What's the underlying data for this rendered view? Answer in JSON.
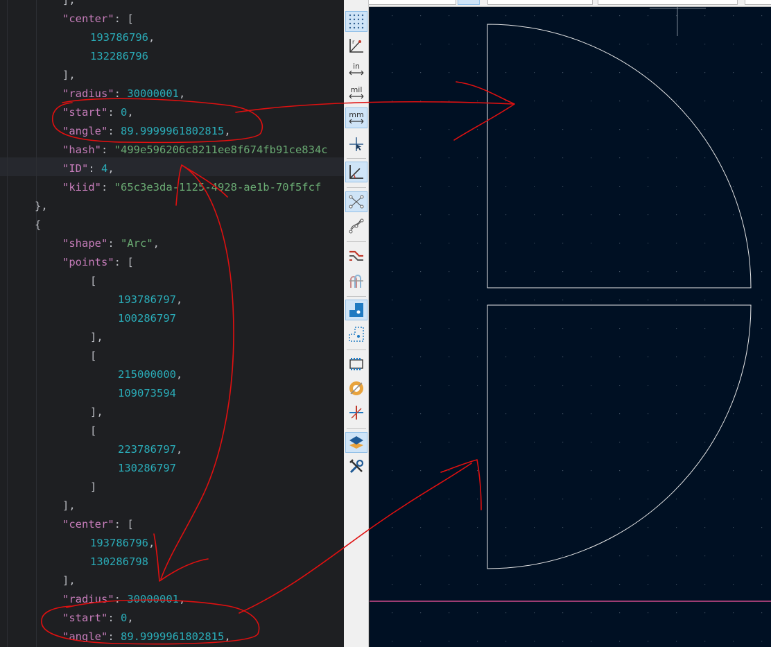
{
  "editor": {
    "lines": [
      {
        "indent": 1,
        "tokens": [
          {
            "t": "pun",
            "v": "],"
          }
        ]
      },
      {
        "indent": 1,
        "tokens": [
          {
            "t": "key",
            "v": "\"center\""
          },
          {
            "t": "pun",
            "v": ": ["
          }
        ]
      },
      {
        "indent": 2,
        "tokens": [
          {
            "t": "num",
            "v": "193786796"
          },
          {
            "t": "pun",
            "v": ","
          }
        ]
      },
      {
        "indent": 2,
        "tokens": [
          {
            "t": "num",
            "v": "132286796"
          }
        ]
      },
      {
        "indent": 1,
        "tokens": [
          {
            "t": "pun",
            "v": "],"
          }
        ]
      },
      {
        "indent": 1,
        "tokens": [
          {
            "t": "key",
            "v": "\"radius\""
          },
          {
            "t": "pun",
            "v": ": "
          },
          {
            "t": "num",
            "v": "30000001"
          },
          {
            "t": "pun",
            "v": ","
          }
        ]
      },
      {
        "indent": 1,
        "tokens": [
          {
            "t": "key",
            "v": "\"start\""
          },
          {
            "t": "pun",
            "v": ": "
          },
          {
            "t": "num",
            "v": "0"
          },
          {
            "t": "pun",
            "v": ","
          }
        ]
      },
      {
        "indent": 1,
        "tokens": [
          {
            "t": "key",
            "v": "\"angle\""
          },
          {
            "t": "pun",
            "v": ": "
          },
          {
            "t": "num",
            "v": "89.9999961802815"
          },
          {
            "t": "pun",
            "v": ","
          }
        ]
      },
      {
        "indent": 1,
        "tokens": [
          {
            "t": "key",
            "v": "\"hash\""
          },
          {
            "t": "pun",
            "v": ": "
          },
          {
            "t": "str",
            "v": "\"499e596206c8211ee8f674fb91ce834c"
          }
        ]
      },
      {
        "indent": 1,
        "tokens": [
          {
            "t": "key",
            "v": "\"ID\""
          },
          {
            "t": "pun",
            "v": ": "
          },
          {
            "t": "num",
            "v": "4"
          },
          {
            "t": "pun",
            "v": ","
          }
        ]
      },
      {
        "indent": 1,
        "tokens": [
          {
            "t": "key",
            "v": "\"kiid\""
          },
          {
            "t": "pun",
            "v": ": "
          },
          {
            "t": "str",
            "v": "\"65c3e3da-1125-4928-ae1b-70f5fcf"
          }
        ]
      },
      {
        "indent": 0,
        "tokens": [
          {
            "t": "pun",
            "v": "},"
          }
        ]
      },
      {
        "indent": 0,
        "tokens": [
          {
            "t": "pun",
            "v": "{"
          }
        ]
      },
      {
        "indent": 1,
        "tokens": [
          {
            "t": "key",
            "v": "\"shape\""
          },
          {
            "t": "pun",
            "v": ": "
          },
          {
            "t": "str",
            "v": "\"Arc\""
          },
          {
            "t": "pun",
            "v": ","
          }
        ]
      },
      {
        "indent": 1,
        "tokens": [
          {
            "t": "key",
            "v": "\"points\""
          },
          {
            "t": "pun",
            "v": ": ["
          }
        ]
      },
      {
        "indent": 2,
        "tokens": [
          {
            "t": "pun",
            "v": "["
          }
        ]
      },
      {
        "indent": 3,
        "tokens": [
          {
            "t": "num",
            "v": "193786797"
          },
          {
            "t": "pun",
            "v": ","
          }
        ]
      },
      {
        "indent": 3,
        "tokens": [
          {
            "t": "num",
            "v": "100286797"
          }
        ]
      },
      {
        "indent": 2,
        "tokens": [
          {
            "t": "pun",
            "v": "],"
          }
        ]
      },
      {
        "indent": 2,
        "tokens": [
          {
            "t": "pun",
            "v": "["
          }
        ]
      },
      {
        "indent": 3,
        "tokens": [
          {
            "t": "num",
            "v": "215000000"
          },
          {
            "t": "pun",
            "v": ","
          }
        ]
      },
      {
        "indent": 3,
        "tokens": [
          {
            "t": "num",
            "v": "109073594"
          }
        ]
      },
      {
        "indent": 2,
        "tokens": [
          {
            "t": "pun",
            "v": "],"
          }
        ]
      },
      {
        "indent": 2,
        "tokens": [
          {
            "t": "pun",
            "v": "["
          }
        ]
      },
      {
        "indent": 3,
        "tokens": [
          {
            "t": "num",
            "v": "223786797"
          },
          {
            "t": "pun",
            "v": ","
          }
        ]
      },
      {
        "indent": 3,
        "tokens": [
          {
            "t": "num",
            "v": "130286797"
          }
        ]
      },
      {
        "indent": 2,
        "tokens": [
          {
            "t": "pun",
            "v": "]"
          }
        ]
      },
      {
        "indent": 1,
        "tokens": [
          {
            "t": "pun",
            "v": "],"
          }
        ]
      },
      {
        "indent": 1,
        "tokens": [
          {
            "t": "key",
            "v": "\"center\""
          },
          {
            "t": "pun",
            "v": ": ["
          }
        ]
      },
      {
        "indent": 2,
        "tokens": [
          {
            "t": "num",
            "v": "193786796"
          },
          {
            "t": "pun",
            "v": ","
          }
        ]
      },
      {
        "indent": 2,
        "tokens": [
          {
            "t": "num",
            "v": "130286798"
          }
        ]
      },
      {
        "indent": 1,
        "tokens": [
          {
            "t": "pun",
            "v": "],"
          }
        ]
      },
      {
        "indent": 1,
        "tokens": [
          {
            "t": "key",
            "v": "\"radius\""
          },
          {
            "t": "pun",
            "v": ": "
          },
          {
            "t": "num",
            "v": "30000001"
          },
          {
            "t": "pun",
            "v": ","
          }
        ]
      },
      {
        "indent": 1,
        "tokens": [
          {
            "t": "key",
            "v": "\"start\""
          },
          {
            "t": "pun",
            "v": ": "
          },
          {
            "t": "num",
            "v": "0"
          },
          {
            "t": "pun",
            "v": ","
          }
        ]
      },
      {
        "indent": 1,
        "tokens": [
          {
            "t": "key",
            "v": "\"angle\""
          },
          {
            "t": "pun",
            "v": ": "
          },
          {
            "t": "num",
            "v": "89.9999961802815"
          },
          {
            "t": "pun",
            "v": ","
          }
        ]
      }
    ]
  },
  "toolbar": {
    "buttons": [
      {
        "name": "grid-toggle-icon",
        "active": true
      },
      {
        "name": "polar-coordinates-icon",
        "active": false
      },
      {
        "name": "units-inch-icon",
        "active": false,
        "label": "in"
      },
      {
        "name": "units-mil-icon",
        "active": false,
        "label": "mil"
      },
      {
        "name": "units-mm-icon",
        "active": true,
        "label": "mm"
      },
      {
        "name": "full-crosshair-icon",
        "active": false
      },
      {
        "name": "angle-snap-icon",
        "active": true
      },
      {
        "name": "ratsnest-icon",
        "active": true
      },
      {
        "name": "curved-ratsnest-icon",
        "active": false
      },
      {
        "name": "track-outline-icon",
        "active": false
      },
      {
        "name": "via-outline-icon",
        "active": false
      },
      {
        "name": "pad-fill-icon",
        "active": true
      },
      {
        "name": "graphic-outline-icon",
        "active": false
      },
      {
        "name": "footprint-outline-icon",
        "active": false
      },
      {
        "name": "zone-fill-icon",
        "active": false
      },
      {
        "name": "net-inspector-icon",
        "active": false
      },
      {
        "name": "layers-manager-icon",
        "active": true
      },
      {
        "name": "properties-tools-icon",
        "active": false
      }
    ]
  },
  "colors": {
    "editor_bg": "#1e1f22",
    "json_key": "#c77dbb",
    "json_number": "#2aacb8",
    "json_string": "#6aab73",
    "canvas_bg": "#001023",
    "grid_dot": "#3d4c5e",
    "arc_stroke": "#e8e8e8",
    "board_edge": "#d04a8c",
    "annotation": "#e01010"
  }
}
